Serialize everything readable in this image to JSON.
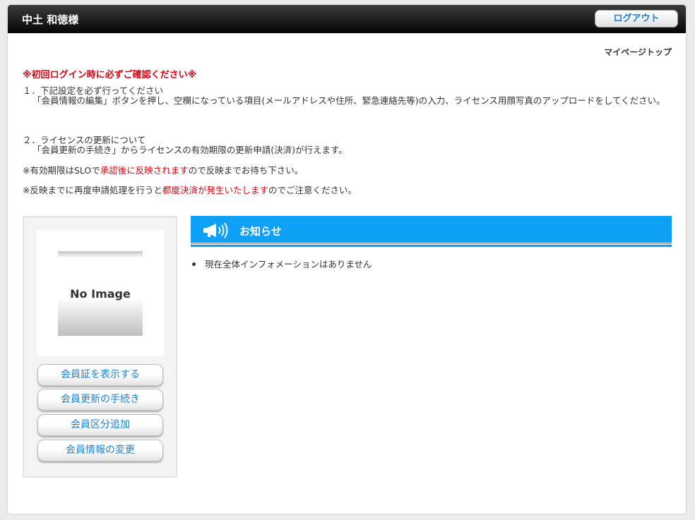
{
  "header": {
    "user_name": "中土 和徳様",
    "logout_label": "ログアウト"
  },
  "breadcrumb": "マイページトップ",
  "notice": {
    "title": "※初回ログイン時に必ずご確認ください※",
    "item1_title": "１．下記設定を必ず行ってください",
    "item1_body": "「会員情報の編集」ボタンを押し、空欄になっている項目(メールアドレスや住所、緊急連絡先等)の入力、ライセンス用顔写真のアップロードをしてください。",
    "item2_title": "２．ライセンスの更新について",
    "item2_body": "「会員更新の手続き」からライセンスの有効期限の更新申請(決済)が行えます。",
    "note1_a": "※有効期限はSLOで",
    "note1_red": "承認後に反映されます",
    "note1_b": "ので反映までお待ち下さい。",
    "note2_a": "※反映までに再度申請処理を行うと",
    "note2_red": "都度決済が発生いたします",
    "note2_b": "のでご注意ください。"
  },
  "profile": {
    "no_image_label": "No Image",
    "buttons": [
      "会員証を表示する",
      "会員更新の手続き",
      "会員区分追加",
      "会員情報の変更"
    ]
  },
  "info": {
    "title": "お知らせ",
    "items": [
      "現在全体インフォメーションはありません"
    ]
  },
  "colors": {
    "accent": "#0ea0f4",
    "link": "#1a82d8",
    "warning": "#e0000f"
  }
}
